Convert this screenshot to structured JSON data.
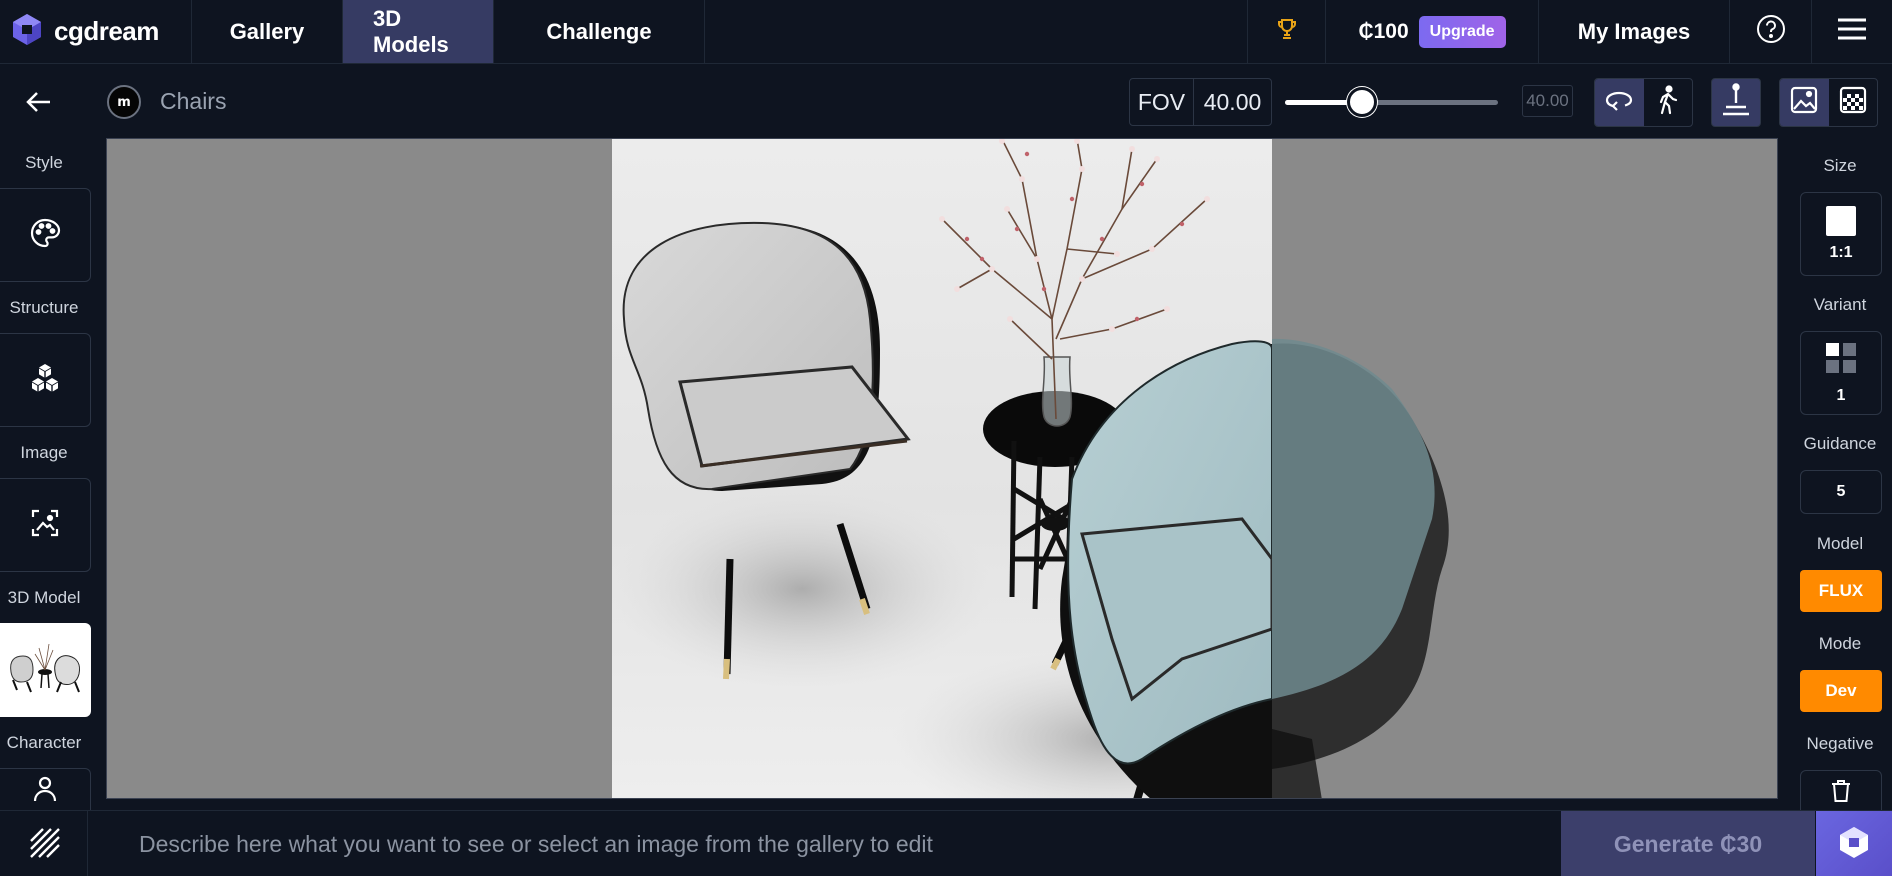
{
  "app": {
    "brand": "cgdream"
  },
  "nav": {
    "gallery": "Gallery",
    "models3d": "3D Models",
    "challenge": "Challenge",
    "credits": "₵100",
    "upgrade": "Upgrade",
    "my_images": "My Images"
  },
  "toolbar": {
    "model_title": "Chairs",
    "model_logo": "m",
    "fov_label": "FOV",
    "fov_value": "40.00",
    "slider_readout": "40.00",
    "slider_fraction": 0.36
  },
  "left_panel": {
    "style_label": "Style",
    "structure_label": "Structure",
    "image_label": "Image",
    "model3d_label": "3D Model",
    "character_label": "Character"
  },
  "right_panel": {
    "size_label": "Size",
    "size_value": "1:1",
    "variant_label": "Variant",
    "variant_value": "1",
    "guidance_label": "Guidance",
    "guidance_value": "5",
    "model_label": "Model",
    "model_value": "FLUX",
    "mode_label": "Mode",
    "mode_value": "Dev",
    "negative_label": "Negative"
  },
  "bottom": {
    "prompt_placeholder": "Describe here what you want to see or select an image from the gallery to edit",
    "generate_label": "Generate ₵30"
  },
  "colors": {
    "background": "#0e1420",
    "active_nav": "#363b63",
    "accent_orange": "#ff8a00",
    "upgrade_purple": "#8b5cf6",
    "canvas_gray": "#8a8a8a"
  },
  "icons": {
    "brand": "cube-logo-icon",
    "trophy": "trophy-icon",
    "help": "help-circle-icon",
    "menu": "hamburger-menu-icon",
    "back": "arrow-left-icon",
    "orbit": "orbit-icon",
    "walk": "walk-icon",
    "single": "single-view-icon",
    "image": "image-icon",
    "transparent": "transparent-background-icon",
    "palette": "palette-icon",
    "cubes": "cubes-icon",
    "image_select": "image-select-icon",
    "character": "character-icon",
    "variant": "grid-icon",
    "trash": "trash-icon",
    "slash": "slash-pattern-icon",
    "generate": "cube-generate-icon"
  }
}
